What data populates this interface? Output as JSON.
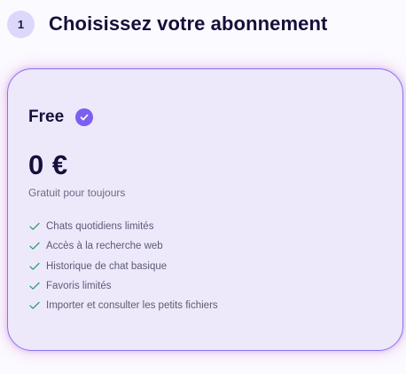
{
  "header": {
    "step_number": "1",
    "title": "Choisissez votre abonnement"
  },
  "plan": {
    "name": "Free",
    "selected": true,
    "price": "0 €",
    "subtitle": "Gratuit pour toujours",
    "features": [
      {
        "label": "Chats quotidiens limités",
        "icon": "check-icon"
      },
      {
        "label": "Accès à la recherche web",
        "icon": "check-icon"
      },
      {
        "label": "Historique de chat basique",
        "icon": "check-icon"
      },
      {
        "label": "Favoris limités",
        "icon": "check-icon"
      },
      {
        "label": "Importer et consulter les petits fichiers",
        "icon": "check-icon"
      }
    ]
  },
  "colors": {
    "accent": "#7d5ff0",
    "card_border": "#8a73f2",
    "card_background": "#ede9fb",
    "check_green": "#2f9e6d",
    "title_text": "#14103a"
  }
}
